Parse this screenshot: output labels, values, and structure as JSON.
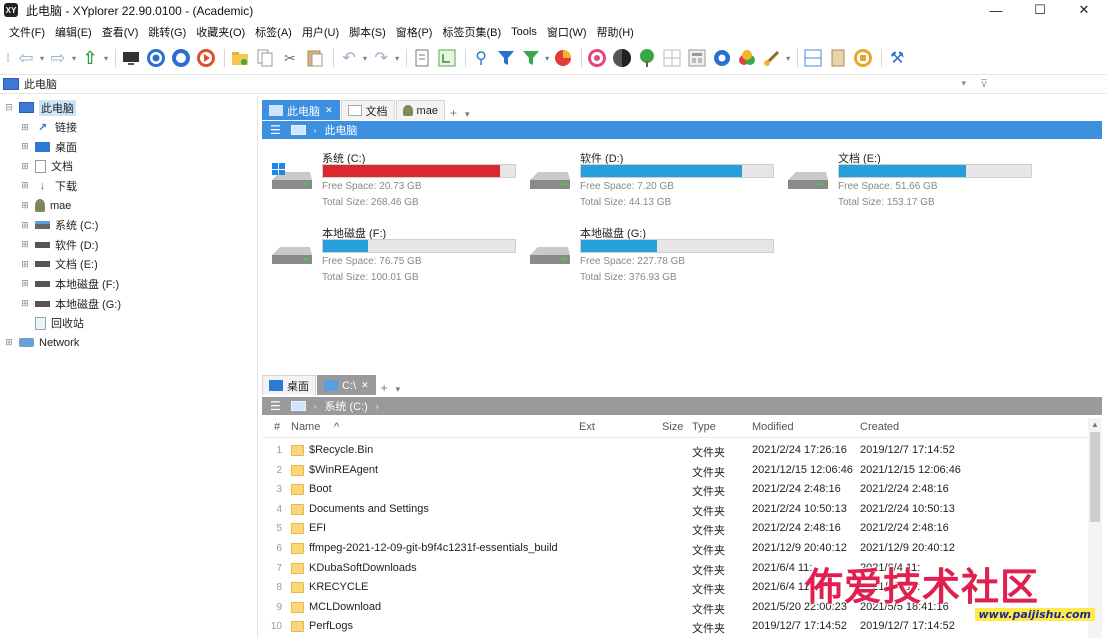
{
  "window": {
    "title": "此电脑 - XYplorer 22.90.0100 - (Academic)",
    "app_icon": "XY",
    "controls": [
      "—",
      "☐",
      "✕"
    ]
  },
  "menu": [
    "文件(F)",
    "编辑(E)",
    "查看(V)",
    "跳转(G)",
    "收藏夹(O)",
    "标签(A)",
    "用户(U)",
    "脚本(S)",
    "窗格(P)",
    "标签页集(B)",
    "Tools",
    "窗口(W)",
    "帮助(H)"
  ],
  "address": {
    "text": "此电脑",
    "dropdown_icon": "chevron-down-icon",
    "filter_icon": "filter-icon"
  },
  "tree": {
    "items": [
      {
        "label": "此电脑",
        "icon": "computer-icon",
        "level": 0,
        "expander": "⊟",
        "selected": true
      },
      {
        "label": "链接",
        "icon": "link-icon",
        "level": 1,
        "expander": "⊞"
      },
      {
        "label": "桌面",
        "icon": "desktop-icon",
        "level": 1,
        "expander": "⊞"
      },
      {
        "label": "文档",
        "icon": "document-icon",
        "level": 1,
        "expander": "⊞"
      },
      {
        "label": "下载",
        "icon": "download-icon",
        "level": 1,
        "expander": "⊞"
      },
      {
        "label": "mae",
        "icon": "user-icon",
        "level": 1,
        "expander": "⊞"
      },
      {
        "label": "系统 (C:)",
        "icon": "system-drive-icon",
        "level": 1,
        "expander": "⊞"
      },
      {
        "label": "软件 (D:)",
        "icon": "drive-icon",
        "level": 1,
        "expander": "⊞"
      },
      {
        "label": "文档 (E:)",
        "icon": "drive-icon",
        "level": 1,
        "expander": "⊞"
      },
      {
        "label": "本地磁盘 (F:)",
        "icon": "drive-icon",
        "level": 1,
        "expander": "⊞"
      },
      {
        "label": "本地磁盘 (G:)",
        "icon": "drive-icon",
        "level": 1,
        "expander": "⊞"
      },
      {
        "label": "回收站",
        "icon": "recycle-bin-icon",
        "level": 1,
        "expander": ""
      },
      {
        "label": "Network",
        "icon": "network-icon",
        "level": 0,
        "expander": "⊞"
      }
    ]
  },
  "pane1": {
    "tabs": [
      {
        "label": "此电脑",
        "icon": "computer-icon",
        "active": true,
        "close": "✕"
      },
      {
        "label": "文档",
        "icon": "document-icon",
        "active": false
      },
      {
        "label": "mae",
        "icon": "user-icon",
        "active": false
      }
    ],
    "tab_add": "+",
    "tab_menu": "▾",
    "breadcrumb": {
      "menu": "☰",
      "separator": "›",
      "label": "此电脑"
    },
    "accent": "#3d8fe0",
    "drives": [
      {
        "name": "系统 (C:)",
        "free": "Free Space: 20.73 GB",
        "total": "Total Size: 268.46 GB",
        "used_fraction": 0.923,
        "color": "#d9282f",
        "system": true
      },
      {
        "name": "软件 (D:)",
        "free": "Free Space: 7.20 GB",
        "total": "Total Size: 44.13 GB",
        "used_fraction": 0.837,
        "color": "#26a0da",
        "system": false
      },
      {
        "name": "文档 (E:)",
        "free": "Free Space: 51.66 GB",
        "total": "Total Size: 153.17 GB",
        "used_fraction": 0.663,
        "color": "#26a0da",
        "system": false
      },
      {
        "name": "本地磁盘 (F:)",
        "free": "Free Space: 76.75 GB",
        "total": "Total Size: 100.01 GB",
        "used_fraction": 0.233,
        "color": "#26a0da",
        "system": false
      },
      {
        "name": "本地磁盘 (G:)",
        "free": "Free Space: 227.78 GB",
        "total": "Total Size: 376.93 GB",
        "used_fraction": 0.396,
        "color": "#26a0da",
        "system": false
      }
    ]
  },
  "pane2": {
    "tabs": [
      {
        "label": "桌面",
        "icon": "desktop-icon",
        "active": false
      },
      {
        "label": "C:\\",
        "icon": "system-drive-icon",
        "active": true,
        "close": "✕"
      }
    ],
    "tab_add": "+",
    "tab_menu": "▾",
    "breadcrumb": {
      "menu": "☰",
      "separator": "›",
      "label": "系统 (C:)",
      "trail": "›"
    },
    "accent": "#9a9a9a",
    "columns": {
      "num": "#",
      "name": "Name",
      "sort": "^",
      "ext": "Ext",
      "size": "Size",
      "type": "Type",
      "modified": "Modified",
      "created": "Created"
    },
    "rows": [
      {
        "num": "1",
        "name": "$Recycle.Bin",
        "type": "文件夹",
        "modified": "2021/2/24 17:26:16",
        "created": "2019/12/7 17:14:52"
      },
      {
        "num": "2",
        "name": "$WinREAgent",
        "type": "文件夹",
        "modified": "2021/12/15 12:06:46",
        "created": "2021/12/15 12:06:46"
      },
      {
        "num": "3",
        "name": "Boot",
        "type": "文件夹",
        "modified": "2021/2/24 2:48:16",
        "created": "2021/2/24 2:48:16"
      },
      {
        "num": "4",
        "name": "Documents and Settings",
        "type": "文件夹",
        "modified": "2021/2/24 10:50:13",
        "created": "2021/2/24 10:50:13"
      },
      {
        "num": "5",
        "name": "EFI",
        "type": "文件夹",
        "modified": "2021/2/24 2:48:16",
        "created": "2021/2/24 2:48:16"
      },
      {
        "num": "6",
        "name": "ffmpeg-2021-12-09-git-b9f4c1231f-essentials_build",
        "type": "文件夹",
        "modified": "2021/12/9 20:40:12",
        "created": "2021/12/9 20:40:12"
      },
      {
        "num": "7",
        "name": "KDubaSoftDownloads",
        "type": "文件夹",
        "modified": "2021/6/4 11:",
        "created": "2021/6/4 11:"
      },
      {
        "num": "8",
        "name": "KRECYCLE",
        "type": "文件夹",
        "modified": "2021/6/4 11:",
        "created": "2021/6/4 11:"
      },
      {
        "num": "9",
        "name": "MCLDownload",
        "type": "文件夹",
        "modified": "2021/5/20 22:00:23",
        "created": "2021/5/5 18:41:16"
      },
      {
        "num": "10",
        "name": "PerfLogs",
        "type": "文件夹",
        "modified": "2019/12/7 17:14:52",
        "created": "2019/12/7 17:14:52"
      }
    ]
  },
  "watermark": {
    "text": "佈爱技术社区",
    "url": "www.paijishu.com"
  }
}
